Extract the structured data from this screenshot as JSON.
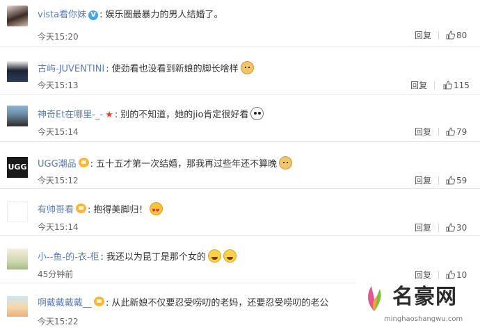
{
  "actions": {
    "reply_label": "回复"
  },
  "comments": [
    {
      "user": "vista看你妹",
      "badge": "verified-v",
      "text": "娱乐圈最暴力的男人结婚了。",
      "emoji": [],
      "time": "今天15:20",
      "likes": "80"
    },
    {
      "user": "古屿-JUVENTINI",
      "badge": "",
      "text": "使劲看也没看到新娘的脚长啥样",
      "emoji": [
        "doge"
      ],
      "time": "今天15:13",
      "likes": "115"
    },
    {
      "user": "神奇Et在哪里-_-",
      "badge": "star",
      "text": "别的不知道，她的jio肯定很好看",
      "emoji": [
        "panda"
      ],
      "time": "今天15:14",
      "likes": "79"
    },
    {
      "user": "UGG潮品",
      "badge": "crown",
      "text": "五十五才第一次结婚，那我再过些年还不算晚",
      "emoji": [
        "doge"
      ],
      "time": "今天15:12",
      "likes": "59"
    },
    {
      "user": "有帅哥看",
      "badge": "crown",
      "text": "抱得美脚归！",
      "emoji": [
        "heart-eyes"
      ],
      "time": "今天15:14",
      "likes": "30"
    },
    {
      "user": "小--鱼-的-衣-柜",
      "badge": "",
      "text": "我还以为昆丁是那个女的",
      "emoji": [
        "laugh-cry",
        "laugh-cry"
      ],
      "time": "45分钟前",
      "likes": "10"
    },
    {
      "user": "啊戴戴戴戴__",
      "badge": "crown",
      "text": "从此新娘不仅要忍受唠叨的老妈，还要忍受唠叨的老公",
      "emoji": [],
      "time": "今天15:22",
      "likes": ""
    }
  ],
  "avatar_4_text": "UGG",
  "watermark": {
    "name": "名豪网",
    "url": "minghaoshangwu.com"
  },
  "colors": {
    "username": "#5a7fb0",
    "divider": "#e6e6e6",
    "text": "#333333",
    "meta": "#666666"
  }
}
